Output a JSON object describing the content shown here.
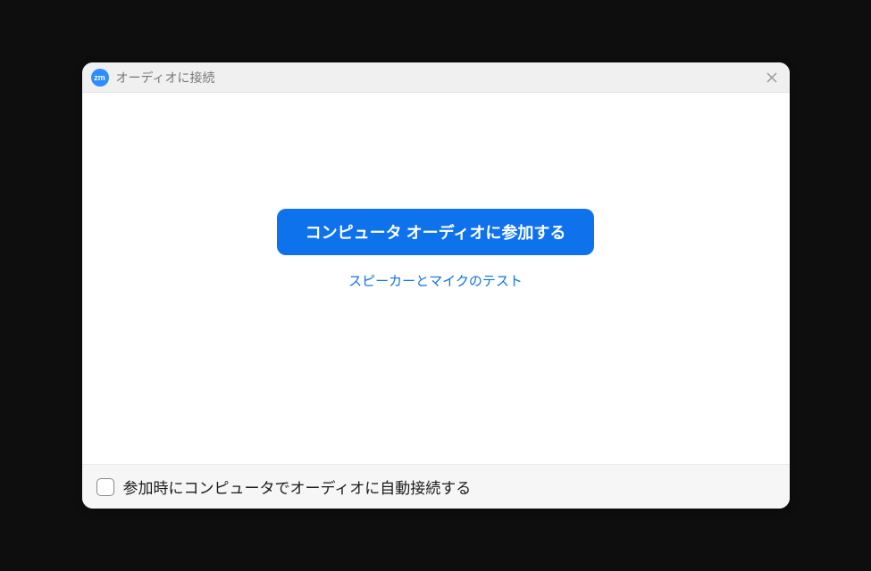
{
  "titlebar": {
    "app_icon_text": "zm",
    "title": "オーディオに接続"
  },
  "content": {
    "join_button_label": "コンピュータ オーディオに参加する",
    "test_link_label": "スピーカーとマイクのテスト"
  },
  "footer": {
    "checkbox_label": "参加時にコンピュータでオーディオに自動接続する",
    "checkbox_checked": false
  }
}
